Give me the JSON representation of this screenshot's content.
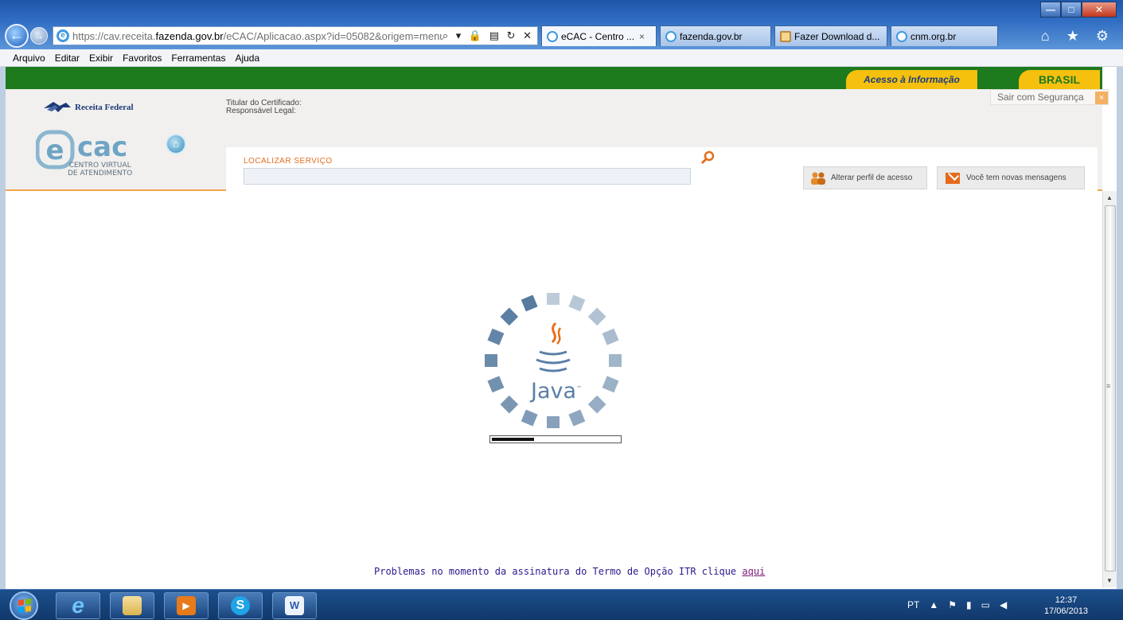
{
  "browser": {
    "url_prefix": "https://cav.receita.",
    "url_domain": "fazenda.gov.br",
    "url_suffix": "/eCAC/Aplicacao.aspx?id=05082&origem=menu",
    "address_icons": "⌕ ▾ 🔒 ▤ ↻ ✕",
    "tabs": [
      {
        "label": "eCAC - Centro ...",
        "close": "×",
        "active": true,
        "icon": "ie-icon"
      },
      {
        "label": "fazenda.gov.br",
        "active": false,
        "icon": "ie-icon"
      },
      {
        "label": "Fazer Download d...",
        "active": false,
        "icon": "download-icon"
      },
      {
        "label": "cnm.org.br",
        "active": false,
        "icon": "ie-icon"
      }
    ],
    "window_buttons": {
      "minimize": "—",
      "maximize": "□",
      "close": "✕"
    },
    "toolbar_icons": "⌂ ★ ⚙"
  },
  "menubar": [
    "Arquivo",
    "Editar",
    "Exibir",
    "Favoritos",
    "Ferramentas",
    "Ajuda"
  ],
  "govbar": {
    "acesso": "Acesso à Informação",
    "brasil": "BRASIL"
  },
  "header": {
    "rf_logo": "Receita Federal",
    "ecac_sub1": "CENTRO VIRTUAL",
    "ecac_sub2": "DE ATENDIMENTO",
    "ecac_logo": "eCAC",
    "titular": "Titular do Certificado:",
    "responsavel": "Responsável Legal:",
    "sair": "Sair com Segurança",
    "sair_close": "×",
    "localizar": "LOCALIZAR SERVIÇO",
    "alterar_perfil": "Alterar perfil de acesso",
    "mensagens": "Você tem novas mensagens",
    "accent": "#e36d1d",
    "gov_green": "#1d7a1d",
    "gov_yellow": "#f6c00f"
  },
  "content": {
    "java_label": "Java",
    "java_tm": "™",
    "progress": 0.35,
    "problemas_text": "Problemas no momento da assinatura do Termo de Opção ITR clique",
    "problemas_link": "aqui"
  },
  "taskbar": {
    "apps": [
      "internet-explorer",
      "file-explorer",
      "media-player",
      "skype",
      "word"
    ],
    "tray_lang": "PT",
    "time": "12:37",
    "date": "17/06/2013"
  }
}
